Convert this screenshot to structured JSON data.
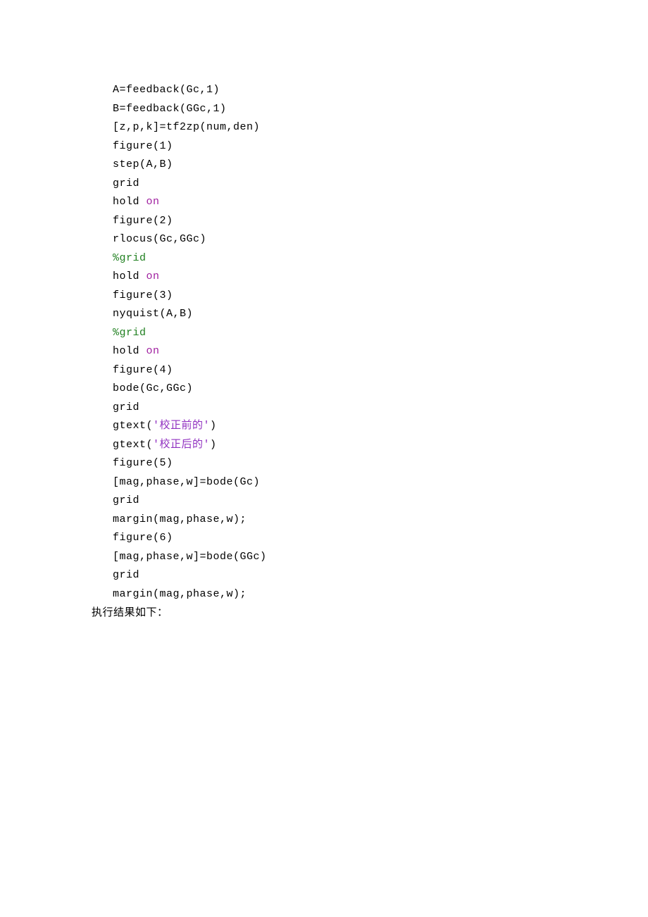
{
  "code": {
    "lines": [
      {
        "t": "A=feedback(Gc,1)"
      },
      {
        "t": "B=feedback(GGc,1)"
      },
      {
        "t": "[z,p,k]=tf2zp(num,den)"
      },
      {
        "t": "figure(1)"
      },
      {
        "t": "step(A,B)"
      },
      {
        "t": "grid"
      },
      {
        "pre": "hold ",
        "kw": "on"
      },
      {
        "t": "figure(2)"
      },
      {
        "t": "rlocus(Gc,GGc)"
      },
      {
        "cm": "%grid"
      },
      {
        "pre": "hold ",
        "kw": "on"
      },
      {
        "t": "figure(3)"
      },
      {
        "t": "nyquist(A,B)"
      },
      {
        "cm": "%grid"
      },
      {
        "pre": "hold ",
        "kw": "on"
      },
      {
        "t": "figure(4)"
      },
      {
        "t": "bode(Gc,GGc)"
      },
      {
        "t": "grid"
      },
      {
        "pre": "gtext(",
        "str": "'校正前的'",
        "post": ")"
      },
      {
        "pre": "gtext(",
        "str": "'校正后的'",
        "post": ")"
      },
      {
        "t": "figure(5)"
      },
      {
        "t": "[mag,phase,w]=bode(Gc)"
      },
      {
        "t": "grid"
      },
      {
        "t": "margin(mag,phase,w);"
      },
      {
        "t": "figure(6)"
      },
      {
        "t": "[mag,phase,w]=bode(GGc)"
      },
      {
        "t": "grid"
      },
      {
        "t": "margin(mag,phase,w);"
      }
    ]
  },
  "result_text": "执行结果如下："
}
